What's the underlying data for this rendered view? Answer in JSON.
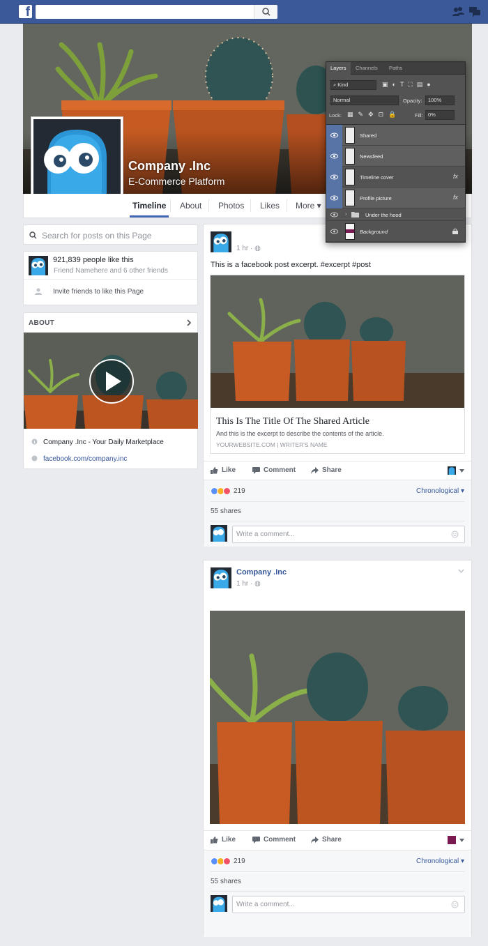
{
  "topbar": {
    "logo": "f",
    "search_placeholder": ""
  },
  "page": {
    "name": "Company .Inc",
    "category": "E-Commerce Platform"
  },
  "nav": {
    "tabs": [
      {
        "label": "Timeline"
      },
      {
        "label": "About"
      },
      {
        "label": "Photos"
      },
      {
        "label": "Likes"
      },
      {
        "label": "More ▾"
      }
    ]
  },
  "sidebar": {
    "search_placeholder": "Search for posts on this Page",
    "likes_count": "921,839 people like this",
    "likes_friends": "Friend Namehere and 6 other friends",
    "invite": "Invite friends to like this Page",
    "about_header": "ABOUT",
    "about_line1": "Company .Inc - Your Daily Marketplace",
    "about_line2": "facebook.com/company.inc"
  },
  "post1": {
    "time": "1 hr · ◍",
    "text": "This is a facebook post excerpt. #excerpt #post",
    "article_title": "This Is The Title Of The Shared Article",
    "article_desc": "And this is the excerpt to describe the contents of the article.",
    "article_site": "YOURWEBSITE.COM | WRITER'S NAME",
    "like": "Like",
    "comment": "Comment",
    "share": "Share",
    "reaction_count": "219",
    "chronological": "Chronological ▾",
    "shares": "55 shares",
    "comment_placeholder": "Write a comment..."
  },
  "post2": {
    "author": "Company .Inc",
    "time": "1 hr · ◍",
    "like": "Like",
    "comment": "Comment",
    "share": "Share",
    "reaction_count": "219",
    "chronological": "Chronological ▾",
    "shares": "55 shares",
    "comment_placeholder": "Write a comment..."
  },
  "layers_panel": {
    "tabs": [
      "Layers",
      "Channels",
      "Paths"
    ],
    "kind": "Kind",
    "blend_mode": "Normal",
    "opacity_label": "Opacity:",
    "opacity_value": "100%",
    "lock_label": "Lock:",
    "fill_label": "Fill:",
    "fill_value": "0%",
    "layers": [
      {
        "name": "Shared"
      },
      {
        "name": "Newsfeed"
      },
      {
        "name": "Timeline cover",
        "fx": "fx"
      },
      {
        "name": "Profile picture",
        "fx": "fx"
      },
      {
        "name": "Under the hood"
      },
      {
        "name": "Background"
      }
    ]
  },
  "colors": {
    "facebook_blue": "#3b5998",
    "link_blue": "#365899",
    "swatch_purple": "#7a1a52"
  }
}
